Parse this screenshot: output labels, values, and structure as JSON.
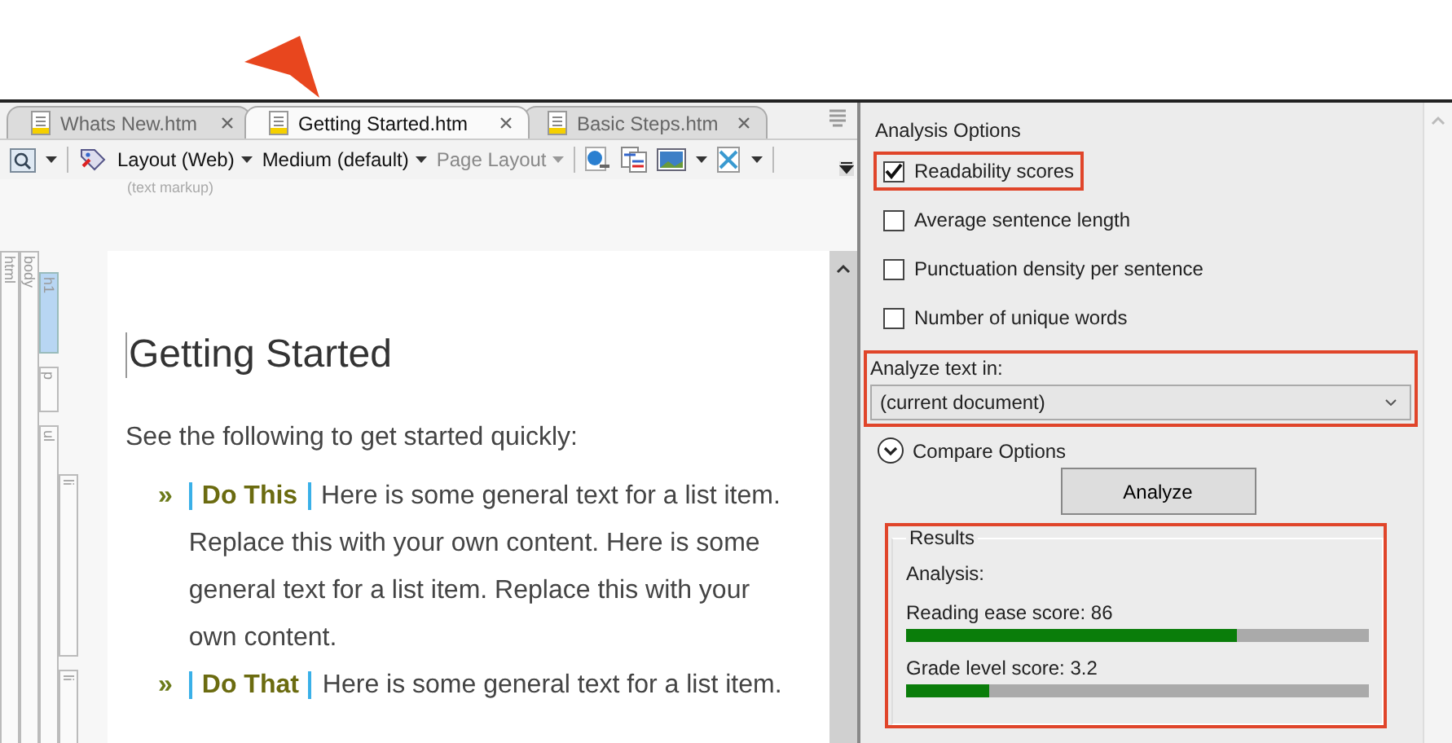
{
  "tabs": [
    {
      "label": "Whats New.htm",
      "selected": false
    },
    {
      "label": "Getting Started.htm",
      "selected": true
    },
    {
      "label": "Basic Steps.htm",
      "selected": false
    }
  ],
  "toolbar": {
    "dropdowns": [
      {
        "label": "Layout (Web)",
        "disabled": false
      },
      {
        "label": "Medium (default)",
        "disabled": false
      },
      {
        "label": "Page Layout",
        "disabled": true
      }
    ]
  },
  "markup_hint": "(text markup)",
  "structure": [
    {
      "label": "html",
      "selected": false,
      "children": [
        {
          "label": "body",
          "selected": false,
          "children": [
            {
              "label": "h1",
              "selected": true
            },
            {
              "label": "p",
              "selected": false
            },
            {
              "label": "ul",
              "selected": false,
              "children": [
                {
                  "label": "li",
                  "selected": false
                },
                {
                  "label": "li",
                  "selected": false
                }
              ]
            }
          ]
        }
      ]
    }
  ],
  "document": {
    "heading": "Getting Started",
    "intro": "See the following to get started quickly:",
    "items": [
      {
        "bullet": "»",
        "term": "Do This",
        "text": "Here is some general text for a list item. Replace this with your own content. Here is some general text for a list item. Replace this with your own content."
      },
      {
        "bullet": "»",
        "term": "Do That",
        "text": "Here is some general text for a list item."
      }
    ]
  },
  "analysis": {
    "title": "Analysis Options",
    "options": [
      {
        "label": "Readability scores",
        "checked": true,
        "highlighted": true
      },
      {
        "label": "Average sentence length",
        "checked": false,
        "highlighted": false
      },
      {
        "label": "Punctuation density per sentence",
        "checked": false,
        "highlighted": false
      },
      {
        "label": "Number of unique words",
        "checked": false,
        "highlighted": false
      }
    ],
    "analyze_in": {
      "label": "Analyze text in:",
      "value": "(current document)",
      "highlighted": true
    },
    "compare_options": {
      "label": "Compare Options",
      "expanded": false
    },
    "analyze_button": "Analyze",
    "results": {
      "title": "Results",
      "highlighted": true,
      "heading": "Analysis:",
      "scores": [
        {
          "label": "Reading ease score: 86",
          "level": 0.715
        },
        {
          "label": "Grade level score: 3.2",
          "level": 0.178
        }
      ]
    }
  }
}
